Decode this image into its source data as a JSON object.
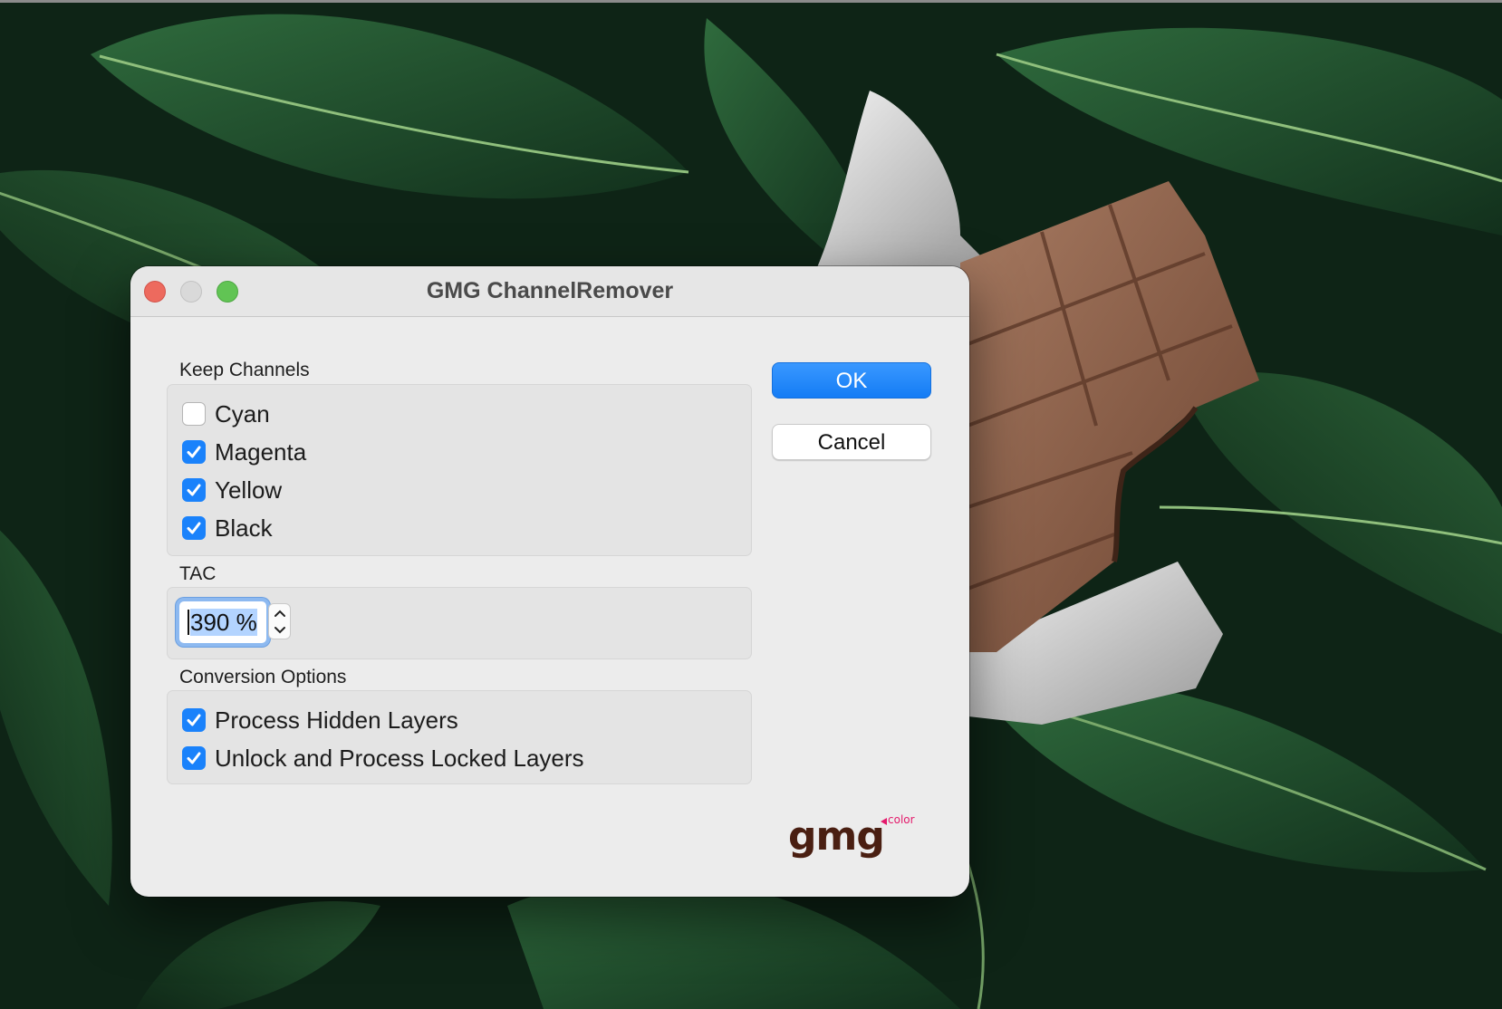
{
  "window": {
    "title": "GMG ChannelRemover"
  },
  "keep_channels": {
    "label": "Keep Channels",
    "items": [
      {
        "label": "Cyan",
        "checked": false
      },
      {
        "label": "Magenta",
        "checked": true
      },
      {
        "label": "Yellow",
        "checked": true
      },
      {
        "label": "Black",
        "checked": true
      }
    ]
  },
  "tac": {
    "label": "TAC",
    "value": "390 %",
    "value_lead": "3",
    "value_rest": "90 %"
  },
  "conversion_options": {
    "label": "Conversion Options",
    "items": [
      {
        "label": "Process Hidden Layers",
        "checked": true
      },
      {
        "label": "Unlock and Process Locked Layers",
        "checked": true
      }
    ]
  },
  "buttons": {
    "ok_label": "OK",
    "cancel_label": "Cancel"
  },
  "logo": {
    "word": "gmg",
    "suffix": "color"
  },
  "colors": {
    "accent": "#1a82fb",
    "logo_brown": "#4a1f12",
    "logo_pink": "#e4196b",
    "close": "#ed6a5e",
    "zoom": "#61c454"
  },
  "icons": [
    "close-window-icon",
    "minimize-window-icon",
    "zoom-window-icon",
    "checkmark-icon",
    "chevron-up-icon",
    "chevron-down-icon"
  ]
}
